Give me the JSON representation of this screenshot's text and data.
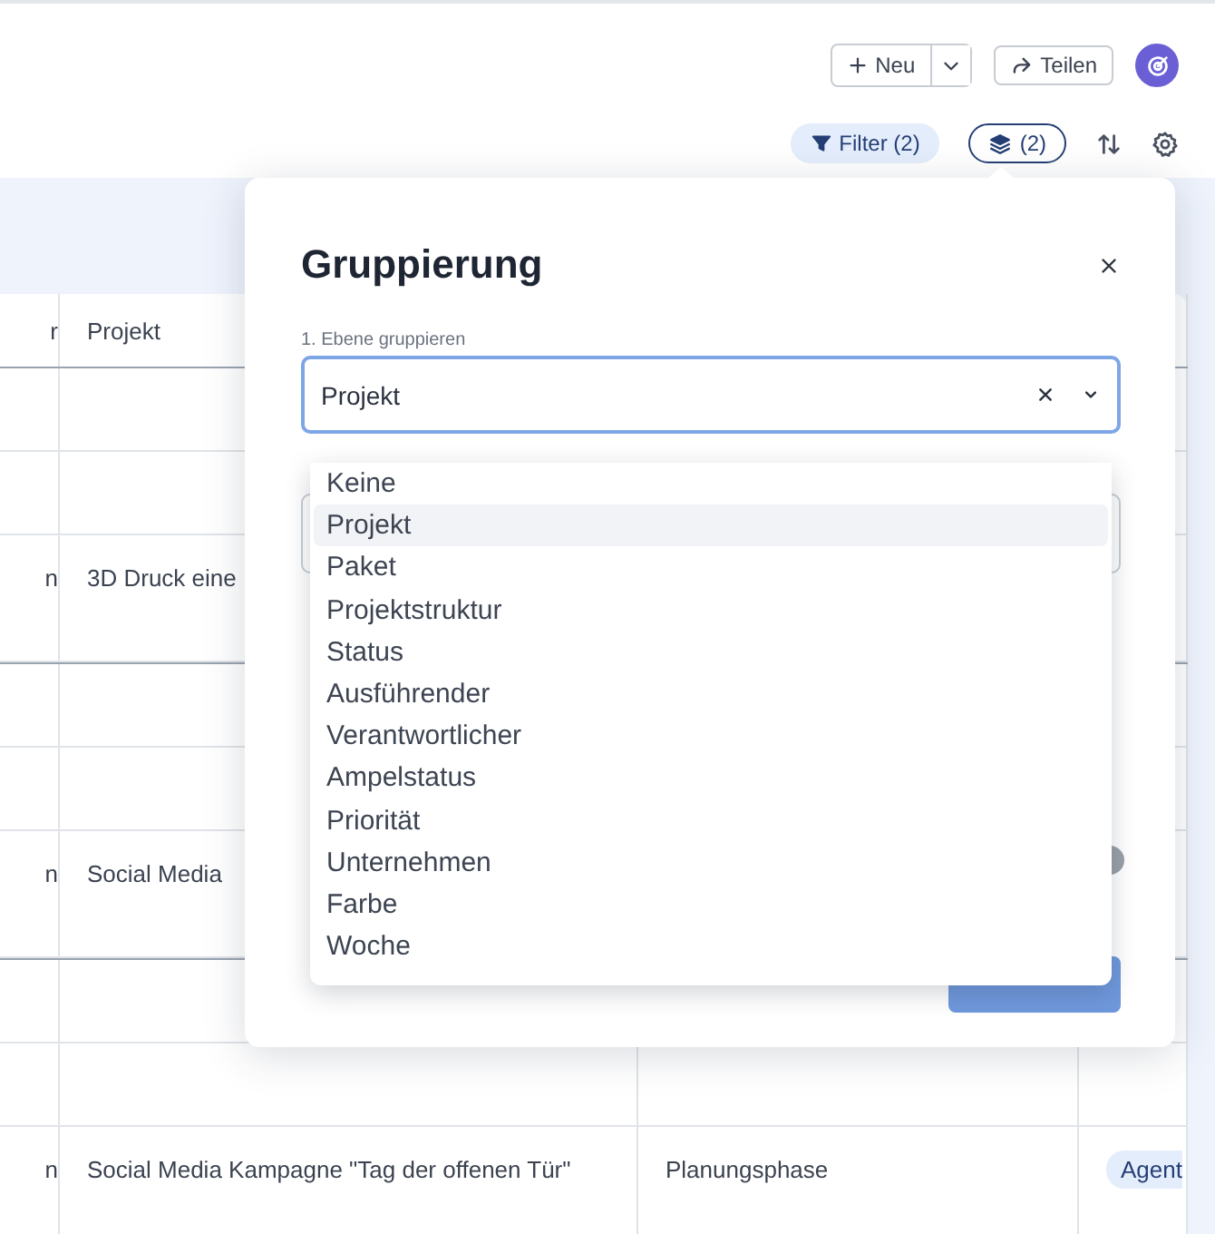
{
  "toolbar": {
    "new_button": "Neu",
    "share_button": "Teilen",
    "filter_button": "Filter (2)",
    "grouping_button": {
      "label": "(2)",
      "selected": true
    }
  },
  "table": {
    "columns": [
      "r",
      "Projekt"
    ],
    "rows": [
      {
        "kind": "spacer"
      },
      {
        "kind": "spacer"
      },
      {
        "kind": "item",
        "column_1": "n",
        "projekt": "3D Druck eine"
      },
      {
        "kind": "spacer"
      },
      {
        "kind": "spacer"
      },
      {
        "kind": "item",
        "column_1": "n",
        "projekt": "Social Media"
      },
      {
        "kind": "spacer"
      },
      {
        "kind": "spacer"
      },
      {
        "kind": "item",
        "column_1": "n",
        "projekt": "Social Media Kampagne \"Tag der offenen Tür\"",
        "column_3": "Planungsphase",
        "column_4": "Agent"
      }
    ]
  },
  "modal": {
    "title": "Gruppierung",
    "level_1": {
      "label": "1. Ebene gruppieren",
      "value": "Projekt",
      "options": [
        {
          "label": "Keine",
          "selected": false
        },
        {
          "label": "Projekt",
          "selected": true
        },
        {
          "label": "Paket",
          "selected": false
        },
        {
          "label": "Projektstruktur",
          "selected": false
        },
        {
          "label": "Status",
          "selected": false
        },
        {
          "label": "Ausführender",
          "selected": false
        },
        {
          "label": "Verantwortlicher",
          "selected": false
        },
        {
          "label": "Ampelstatus",
          "selected": false
        },
        {
          "label": "Priorität",
          "selected": false
        },
        {
          "label": "Unternehmen",
          "selected": false
        },
        {
          "label": "Farbe",
          "selected": false
        },
        {
          "label": "Woche",
          "selected": false
        }
      ]
    },
    "toggle": {
      "on": false
    }
  }
}
